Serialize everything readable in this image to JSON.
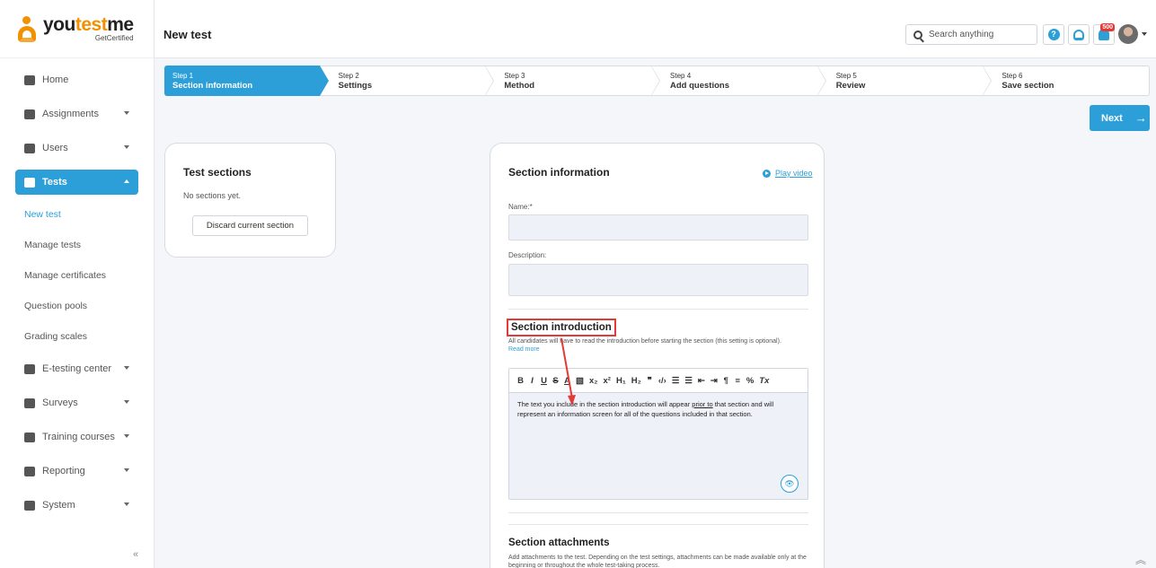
{
  "logo": {
    "main_prefix": "you",
    "main_accent": "test",
    "main_suffix": "me",
    "sub": "GetCertified"
  },
  "sidebar": {
    "items": [
      {
        "label": "Home"
      },
      {
        "label": "Assignments"
      },
      {
        "label": "Users"
      },
      {
        "label": "Tests"
      },
      {
        "label": "E-testing center"
      },
      {
        "label": "Surveys"
      },
      {
        "label": "Training courses"
      },
      {
        "label": "Reporting"
      },
      {
        "label": "System"
      }
    ],
    "subitems": [
      {
        "label": "New test"
      },
      {
        "label": "Manage tests"
      },
      {
        "label": "Manage certificates"
      },
      {
        "label": "Question pools"
      },
      {
        "label": "Grading scales"
      }
    ],
    "collapse": "«"
  },
  "header": {
    "title": "New test",
    "search_placeholder": "Search anything",
    "help": "?",
    "notification_count": "500"
  },
  "steps": [
    {
      "num": "Step 1",
      "label": "Section information"
    },
    {
      "num": "Step 2",
      "label": "Settings"
    },
    {
      "num": "Step 3",
      "label": "Method"
    },
    {
      "num": "Step 4",
      "label": "Add questions"
    },
    {
      "num": "Step 5",
      "label": "Review"
    },
    {
      "num": "Step 6",
      "label": "Save section"
    }
  ],
  "next_label": "Next",
  "next_arrow": "→",
  "sections_card": {
    "title": "Test sections",
    "empty": "No sections yet.",
    "discard": "Discard current section"
  },
  "info": {
    "title": "Section information",
    "play_video": "Play video",
    "name_label": "Name:*",
    "name_value": "",
    "description_label": "Description:",
    "description_value": "",
    "intro_title": "Section introduction",
    "intro_desc": "All candidates will have to read the introduction before starting the section (this setting is optional).",
    "intro_read_more": "Read more",
    "toolbar": [
      "B",
      "I",
      "U",
      "S",
      "A",
      "▧",
      "x₂",
      "x²",
      "H₁",
      "H₂",
      "❞",
      "‹/›",
      "☰",
      "☰",
      "⇤",
      "⇥",
      "¶",
      "≡",
      "%",
      "Tx"
    ],
    "editor_text_1": "The text you include in the section introduction will appear ",
    "editor_text_underlined": "prior to",
    "editor_text_2": " that section and will represent an information screen for all of the questions included in that section.",
    "preview_icon": "👁",
    "attach_title": "Section attachments",
    "attach_desc": "Add attachments to the test. Depending on the test settings, attachments can be made available only at the beginning or throughout the whole test-taking process."
  },
  "scroll_top": "︽",
  "colors": {
    "accent": "#2c9fd9",
    "logo": "#f29100",
    "highlight": "#e53935"
  }
}
